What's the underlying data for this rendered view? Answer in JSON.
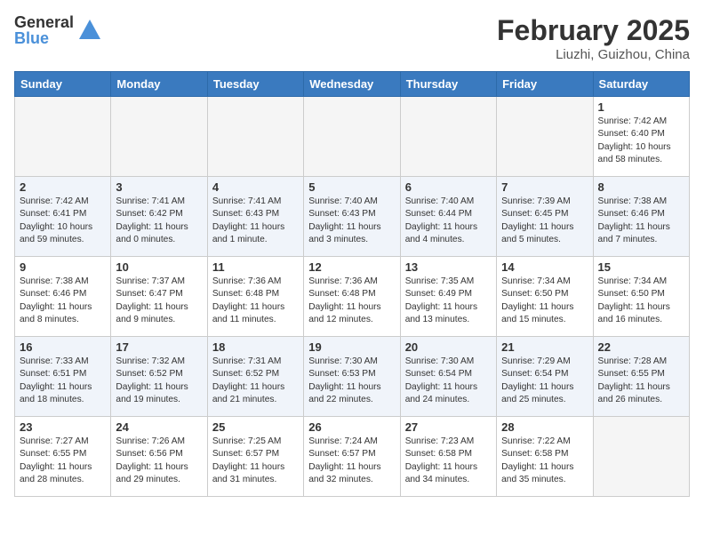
{
  "header": {
    "logo_general": "General",
    "logo_blue": "Blue",
    "month_title": "February 2025",
    "location": "Liuzhi, Guizhou, China"
  },
  "weekdays": [
    "Sunday",
    "Monday",
    "Tuesday",
    "Wednesday",
    "Thursday",
    "Friday",
    "Saturday"
  ],
  "weeks": [
    [
      {
        "day": "",
        "info": ""
      },
      {
        "day": "",
        "info": ""
      },
      {
        "day": "",
        "info": ""
      },
      {
        "day": "",
        "info": ""
      },
      {
        "day": "",
        "info": ""
      },
      {
        "day": "",
        "info": ""
      },
      {
        "day": "1",
        "info": "Sunrise: 7:42 AM\nSunset: 6:40 PM\nDaylight: 10 hours\nand 58 minutes."
      }
    ],
    [
      {
        "day": "2",
        "info": "Sunrise: 7:42 AM\nSunset: 6:41 PM\nDaylight: 10 hours\nand 59 minutes."
      },
      {
        "day": "3",
        "info": "Sunrise: 7:41 AM\nSunset: 6:42 PM\nDaylight: 11 hours\nand 0 minutes."
      },
      {
        "day": "4",
        "info": "Sunrise: 7:41 AM\nSunset: 6:43 PM\nDaylight: 11 hours\nand 1 minute."
      },
      {
        "day": "5",
        "info": "Sunrise: 7:40 AM\nSunset: 6:43 PM\nDaylight: 11 hours\nand 3 minutes."
      },
      {
        "day": "6",
        "info": "Sunrise: 7:40 AM\nSunset: 6:44 PM\nDaylight: 11 hours\nand 4 minutes."
      },
      {
        "day": "7",
        "info": "Sunrise: 7:39 AM\nSunset: 6:45 PM\nDaylight: 11 hours\nand 5 minutes."
      },
      {
        "day": "8",
        "info": "Sunrise: 7:38 AM\nSunset: 6:46 PM\nDaylight: 11 hours\nand 7 minutes."
      }
    ],
    [
      {
        "day": "9",
        "info": "Sunrise: 7:38 AM\nSunset: 6:46 PM\nDaylight: 11 hours\nand 8 minutes."
      },
      {
        "day": "10",
        "info": "Sunrise: 7:37 AM\nSunset: 6:47 PM\nDaylight: 11 hours\nand 9 minutes."
      },
      {
        "day": "11",
        "info": "Sunrise: 7:36 AM\nSunset: 6:48 PM\nDaylight: 11 hours\nand 11 minutes."
      },
      {
        "day": "12",
        "info": "Sunrise: 7:36 AM\nSunset: 6:48 PM\nDaylight: 11 hours\nand 12 minutes."
      },
      {
        "day": "13",
        "info": "Sunrise: 7:35 AM\nSunset: 6:49 PM\nDaylight: 11 hours\nand 13 minutes."
      },
      {
        "day": "14",
        "info": "Sunrise: 7:34 AM\nSunset: 6:50 PM\nDaylight: 11 hours\nand 15 minutes."
      },
      {
        "day": "15",
        "info": "Sunrise: 7:34 AM\nSunset: 6:50 PM\nDaylight: 11 hours\nand 16 minutes."
      }
    ],
    [
      {
        "day": "16",
        "info": "Sunrise: 7:33 AM\nSunset: 6:51 PM\nDaylight: 11 hours\nand 18 minutes."
      },
      {
        "day": "17",
        "info": "Sunrise: 7:32 AM\nSunset: 6:52 PM\nDaylight: 11 hours\nand 19 minutes."
      },
      {
        "day": "18",
        "info": "Sunrise: 7:31 AM\nSunset: 6:52 PM\nDaylight: 11 hours\nand 21 minutes."
      },
      {
        "day": "19",
        "info": "Sunrise: 7:30 AM\nSunset: 6:53 PM\nDaylight: 11 hours\nand 22 minutes."
      },
      {
        "day": "20",
        "info": "Sunrise: 7:30 AM\nSunset: 6:54 PM\nDaylight: 11 hours\nand 24 minutes."
      },
      {
        "day": "21",
        "info": "Sunrise: 7:29 AM\nSunset: 6:54 PM\nDaylight: 11 hours\nand 25 minutes."
      },
      {
        "day": "22",
        "info": "Sunrise: 7:28 AM\nSunset: 6:55 PM\nDaylight: 11 hours\nand 26 minutes."
      }
    ],
    [
      {
        "day": "23",
        "info": "Sunrise: 7:27 AM\nSunset: 6:55 PM\nDaylight: 11 hours\nand 28 minutes."
      },
      {
        "day": "24",
        "info": "Sunrise: 7:26 AM\nSunset: 6:56 PM\nDaylight: 11 hours\nand 29 minutes."
      },
      {
        "day": "25",
        "info": "Sunrise: 7:25 AM\nSunset: 6:57 PM\nDaylight: 11 hours\nand 31 minutes."
      },
      {
        "day": "26",
        "info": "Sunrise: 7:24 AM\nSunset: 6:57 PM\nDaylight: 11 hours\nand 32 minutes."
      },
      {
        "day": "27",
        "info": "Sunrise: 7:23 AM\nSunset: 6:58 PM\nDaylight: 11 hours\nand 34 minutes."
      },
      {
        "day": "28",
        "info": "Sunrise: 7:22 AM\nSunset: 6:58 PM\nDaylight: 11 hours\nand 35 minutes."
      },
      {
        "day": "",
        "info": ""
      }
    ]
  ]
}
